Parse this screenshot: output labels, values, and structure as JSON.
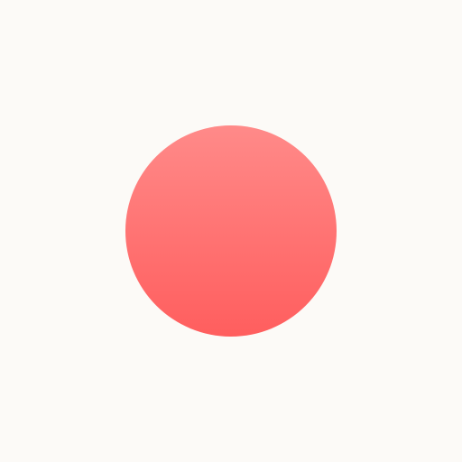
{
  "background_color": "#FCFAF7",
  "shape": {
    "type": "circle",
    "gradient_top": "#FF8A89",
    "gradient_bottom": "#FF5E5E"
  }
}
